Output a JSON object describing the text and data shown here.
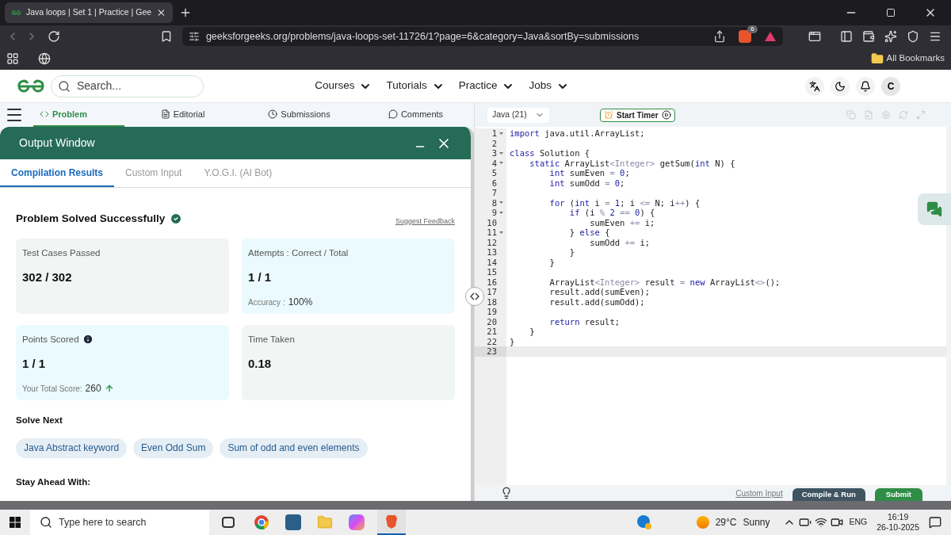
{
  "browser": {
    "tab_title": "Java loops | Set 1 | Practice | Gee",
    "url": "geeksforgeeks.org/problems/java-loops-set-11726/1?page=6&category=Java&sortBy=submissions",
    "shield_count": "6",
    "bookmarks_label": "All Bookmarks"
  },
  "site": {
    "search_placeholder": "Search...",
    "nav": [
      "Courses",
      "Tutorials",
      "Practice",
      "Jobs"
    ],
    "avatar": "C"
  },
  "problem_tabs": [
    {
      "label": "Problem",
      "kind": "code",
      "selected": true
    },
    {
      "label": "Editorial",
      "kind": "doc",
      "selected": false
    },
    {
      "label": "Submissions",
      "kind": "clock",
      "selected": false
    },
    {
      "label": "Comments",
      "kind": "chat",
      "selected": false
    }
  ],
  "output_window": {
    "title": "Output Window",
    "tabs": [
      {
        "label": "Compilation Results",
        "selected": true
      },
      {
        "label": "Custom Input",
        "selected": false
      },
      {
        "label": "Y.O.G.I. (AI Bot)",
        "selected": false
      }
    ],
    "status": "Problem Solved Successfully",
    "feedback_link": "Suggest Feedback",
    "cards": [
      {
        "label": "Test Cases Passed",
        "value": "302 / 302",
        "color": "#f1f6f5"
      },
      {
        "label": "Attempts : Correct / Total",
        "value": "1 / 1",
        "color": "#ebfafe",
        "extra_label": "Accuracy :",
        "extra_value": "100%"
      },
      {
        "label": "Points Scored",
        "value": "1 / 1",
        "color": "#ebfafe",
        "info": true,
        "extra_label": "Your Total Score:",
        "extra_value": "260",
        "trend": true
      },
      {
        "label": "Time Taken",
        "value": "0.18",
        "color": "#f1f6f5"
      }
    ],
    "solve_next_heading": "Solve Next",
    "solve_next": [
      "Java Abstract keyword",
      "Even Odd Sum",
      "Sum of odd and even elements"
    ],
    "stay_ahead_heading": "Stay Ahead With:"
  },
  "editor": {
    "language": "Java (21)",
    "timer_button": "Start Timer",
    "lines": [
      {
        "number": "1",
        "fold": true,
        "active": false,
        "tokens": [
          {
            "kind": "kw",
            "text": "import"
          },
          {
            "kind": "plain",
            "text": " java.util.ArrayList;"
          }
        ]
      },
      {
        "number": "2",
        "fold": false,
        "active": false
      },
      {
        "number": "3",
        "fold": true,
        "active": false,
        "tokens": [
          {
            "kind": "kw",
            "text": "class"
          },
          {
            "kind": "plain",
            "text": " Solution {"
          }
        ]
      },
      {
        "number": "4",
        "fold": true,
        "active": false,
        "tokens": [
          {
            "kind": "kw",
            "text": "    static"
          },
          {
            "kind": "plain",
            "text": " ArrayList"
          },
          {
            "kind": "op",
            "text": "<Integer>"
          },
          {
            "kind": "plain",
            "text": " getSum("
          },
          {
            "kind": "kw",
            "text": "int"
          },
          {
            "kind": "plain",
            "text": " N) {"
          }
        ]
      },
      {
        "number": "5",
        "fold": false,
        "active": false,
        "tokens": [
          {
            "kind": "kw",
            "text": "        int"
          },
          {
            "kind": "plain",
            "text": " sumEven "
          },
          {
            "kind": "op",
            "text": "= "
          },
          {
            "kind": "num",
            "text": "0"
          },
          {
            "kind": "plain",
            "text": ";"
          }
        ]
      },
      {
        "number": "6",
        "fold": false,
        "active": false,
        "tokens": [
          {
            "kind": "kw",
            "text": "        int"
          },
          {
            "kind": "plain",
            "text": " sumOdd "
          },
          {
            "kind": "op",
            "text": "= "
          },
          {
            "kind": "num",
            "text": "0"
          },
          {
            "kind": "plain",
            "text": ";"
          }
        ]
      },
      {
        "number": "7",
        "fold": false,
        "active": false
      },
      {
        "number": "8",
        "fold": true,
        "active": false,
        "tokens": [
          {
            "kind": "kw",
            "text": "        for"
          },
          {
            "kind": "plain",
            "text": " ("
          },
          {
            "kind": "kw",
            "text": "int"
          },
          {
            "kind": "plain",
            "text": " i "
          },
          {
            "kind": "op",
            "text": "= "
          },
          {
            "kind": "num",
            "text": "1"
          },
          {
            "kind": "plain",
            "text": "; i "
          },
          {
            "kind": "op",
            "text": "<="
          },
          {
            "kind": "plain",
            "text": " N; i"
          },
          {
            "kind": "op",
            "text": "++"
          },
          {
            "kind": "plain",
            "text": ") {"
          }
        ]
      },
      {
        "number": "9",
        "fold": true,
        "active": false,
        "tokens": [
          {
            "kind": "kw",
            "text": "            if"
          },
          {
            "kind": "plain",
            "text": " (i "
          },
          {
            "kind": "op",
            "text": "% "
          },
          {
            "kind": "num",
            "text": "2 "
          },
          {
            "kind": "op",
            "text": "== "
          },
          {
            "kind": "num",
            "text": "0"
          },
          {
            "kind": "plain",
            "text": ") {"
          }
        ]
      },
      {
        "number": "10",
        "fold": false,
        "active": false,
        "tokens": [
          {
            "kind": "plain",
            "text": "                sumEven "
          },
          {
            "kind": "op",
            "text": "+="
          },
          {
            "kind": "plain",
            "text": " i;"
          }
        ]
      },
      {
        "number": "11",
        "fold": true,
        "active": false,
        "tokens": [
          {
            "kind": "plain",
            "text": "            } "
          },
          {
            "kind": "kw",
            "text": "else"
          },
          {
            "kind": "plain",
            "text": " {"
          }
        ]
      },
      {
        "number": "12",
        "fold": false,
        "active": false,
        "tokens": [
          {
            "kind": "plain",
            "text": "                sumOdd "
          },
          {
            "kind": "op",
            "text": "+="
          },
          {
            "kind": "plain",
            "text": " i;"
          }
        ]
      },
      {
        "number": "13",
        "fold": false,
        "active": false,
        "tokens": [
          {
            "kind": "plain",
            "text": "            }"
          }
        ]
      },
      {
        "number": "14",
        "fold": false,
        "active": false,
        "tokens": [
          {
            "kind": "plain",
            "text": "        }"
          }
        ]
      },
      {
        "number": "15",
        "fold": false,
        "active": false
      },
      {
        "number": "16",
        "fold": false,
        "active": false,
        "tokens": [
          {
            "kind": "plain",
            "text": "        ArrayList"
          },
          {
            "kind": "op",
            "text": "<Integer>"
          },
          {
            "kind": "plain",
            "text": " result "
          },
          {
            "kind": "op",
            "text": "= "
          },
          {
            "kind": "kw",
            "text": "new"
          },
          {
            "kind": "plain",
            "text": " ArrayList"
          },
          {
            "kind": "op",
            "text": "<>"
          },
          {
            "kind": "plain",
            "text": "();"
          }
        ]
      },
      {
        "number": "17",
        "fold": false,
        "active": false,
        "tokens": [
          {
            "kind": "plain",
            "text": "        result.add(sumEven);"
          }
        ]
      },
      {
        "number": "18",
        "fold": false,
        "active": false,
        "tokens": [
          {
            "kind": "plain",
            "text": "        result.add(sumOdd);"
          }
        ]
      },
      {
        "number": "19",
        "fold": false,
        "active": false
      },
      {
        "number": "20",
        "fold": false,
        "active": false,
        "tokens": [
          {
            "kind": "kw",
            "text": "        return"
          },
          {
            "kind": "plain",
            "text": " result;"
          }
        ]
      },
      {
        "number": "21",
        "fold": false,
        "active": false,
        "tokens": [
          {
            "kind": "plain",
            "text": "    }"
          }
        ]
      },
      {
        "number": "22",
        "fold": false,
        "active": false,
        "tokens": [
          {
            "kind": "plain",
            "text": "}"
          }
        ]
      },
      {
        "number": "23",
        "fold": false,
        "active": true
      }
    ],
    "custom_input_link": "Custom Input",
    "compile_button": "Compile & Run",
    "submit_button": "Submit"
  },
  "taskbar": {
    "search_placeholder": "Type here to search",
    "temperature": "29°C",
    "weather": "Sunny",
    "language": "ENG",
    "time": "16:19",
    "date": "26-10-2025"
  }
}
